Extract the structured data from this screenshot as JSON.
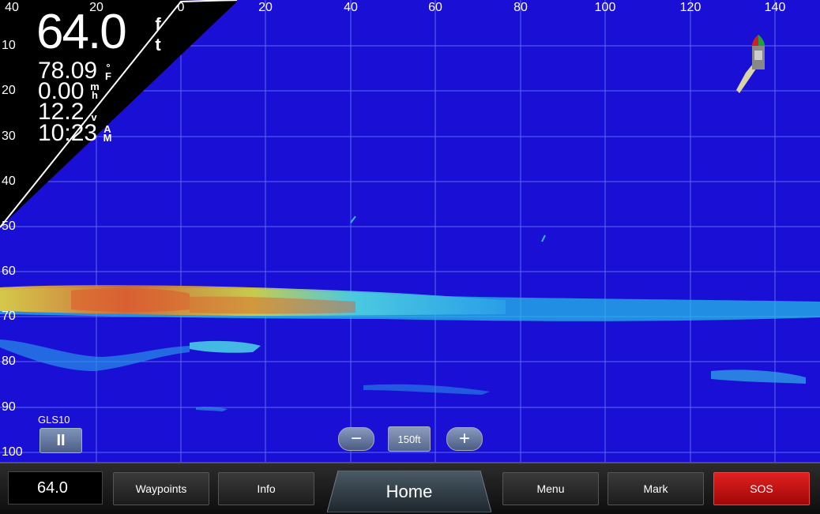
{
  "depth": {
    "value": "64.0",
    "unit_top": "f",
    "unit_bottom": "t"
  },
  "water_temp": {
    "value": "78.09",
    "unit_top": "°",
    "unit_bottom": "F"
  },
  "speed": {
    "value": "0.00",
    "unit_top": "m",
    "unit_bottom": "h"
  },
  "voltage": {
    "value": "12.2",
    "unit": "v"
  },
  "time": {
    "value": "10:23",
    "unit_top": "A",
    "unit_bottom": "M"
  },
  "x_ticks": [
    "40",
    "20",
    "0",
    "20",
    "40",
    "60",
    "80",
    "100",
    "120",
    "140"
  ],
  "y_ticks": [
    "10",
    "20",
    "30",
    "40",
    "50",
    "60",
    "70",
    "80",
    "90",
    "100"
  ],
  "transducer_label": "GLS10",
  "pause_symbol": "II",
  "zoom": {
    "minus": "−",
    "plus": "+",
    "range": "150ft"
  },
  "bottom_bar": {
    "depth_field": "64.0",
    "waypoints": "Waypoints",
    "info": "Info",
    "home": "Home",
    "menu": "Menu",
    "mark": "Mark",
    "sos": "SOS"
  },
  "colors": {
    "water": "#1a0fd4",
    "sos": "#d01010",
    "overlay": "#000000"
  },
  "icons": {
    "boat": "boat-icon",
    "pause": "pause-icon"
  }
}
